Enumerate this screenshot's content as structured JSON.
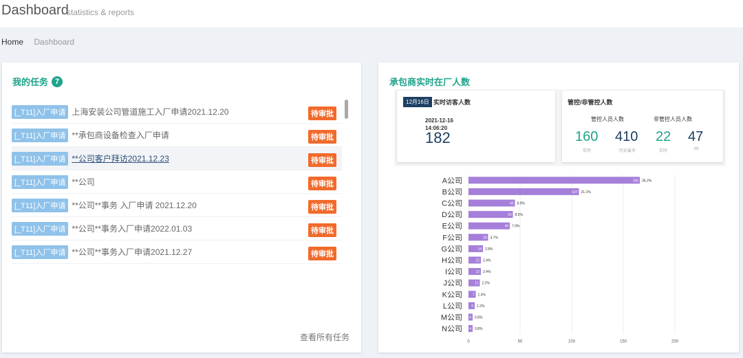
{
  "header": {
    "title": "Dashboard",
    "subtitle": "statistics & reports"
  },
  "breadcrumb": {
    "home": "Home",
    "current": "Dashboard"
  },
  "tasks_panel": {
    "title": "我的任务",
    "count": "7",
    "view_all": "查看所有任务",
    "items": [
      {
        "type": "[_T11]入厂申请",
        "text": "上海安装公司管道施工入厂申请2021.12.20",
        "status": "待审批"
      },
      {
        "type": "[_T11]入厂申请",
        "text": "**承包商设备检查入厂申请",
        "status": "待审批"
      },
      {
        "type": "[_T11]入厂申请",
        "text": "**公司客户拜访2021.12.23",
        "status": "待审批"
      },
      {
        "type": "[_T11]入厂申请",
        "text": "**公司",
        "status": "待审批"
      },
      {
        "type": "[_T11]入厂申请",
        "text": "**公司**事务 入厂申请 2021.12.20",
        "status": "待审批"
      },
      {
        "type": "[_T11]入厂申请",
        "text": "**公司**事务入厂申请2022.01.03",
        "status": "待审批"
      },
      {
        "type": "[_T11]入厂申请",
        "text": "**公司**事务入厂申请2021.12.27",
        "status": "待审批"
      }
    ]
  },
  "contractor_panel": {
    "title": "承包商实时在厂人数",
    "visitors": {
      "date_tag": "12月16日",
      "label": "实时访客人数",
      "date": "2021-12-16",
      "time": "14:06:20",
      "count": "182"
    },
    "control": {
      "title": "管控/非管控人数",
      "controlled_label": "管控人员人数",
      "uncontrolled_label": "非管控人员人数",
      "controlled_realtime": "160",
      "controlled_realtime_label": "实时",
      "controlled_history": "410",
      "controlled_history_label": "历史最多",
      "uncontrolled_realtime": "22",
      "uncontrolled_realtime_label": "实时",
      "uncontrolled_history": "47",
      "uncontrolled_history_label": "89"
    }
  },
  "colors": {
    "accent": "#1ea38b",
    "badge": "#f26a2b",
    "tag": "#8fc2ea",
    "navy": "#1c3f63",
    "bar": "#a57fda"
  },
  "chart_data": {
    "type": "bar",
    "orientation": "horizontal",
    "categories": [
      "A公司",
      "B公司",
      "C公司",
      "D公司",
      "E公司",
      "F公司",
      "G公司",
      "H公司",
      "I公司",
      "J公司",
      "K公司",
      "L公司",
      "M公司",
      "N公司"
    ],
    "values": [
      166,
      107,
      45,
      43,
      40,
      19,
      14,
      12,
      12,
      11,
      7,
      6,
      4,
      4
    ],
    "percent_labels": [
      "36.2%",
      "21.1%",
      "8.9%",
      "8.5%",
      "7.9%",
      "3.7%",
      "2.8%",
      "2.4%",
      "2.4%",
      "2.2%",
      "1.4%",
      "1.2%",
      "0.8%",
      "0.8%"
    ],
    "xticks": [
      0,
      50,
      100,
      150,
      200
    ],
    "xlim": [
      0,
      200
    ],
    "grid": true
  }
}
